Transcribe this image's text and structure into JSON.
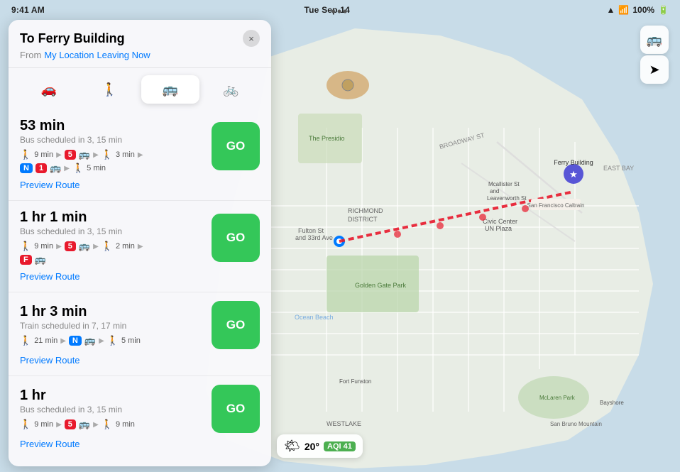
{
  "status_bar": {
    "time": "9:41 AM",
    "date": "Tue Sep 14",
    "battery": "100%",
    "signal_icon": "▲",
    "wifi_icon": "wifi"
  },
  "top_dots": "•••",
  "header": {
    "title": "To Ferry Building",
    "from_label": "From",
    "my_location": "My Location",
    "leaving_now": "Leaving Now",
    "close_icon": "×"
  },
  "mode_tabs": [
    {
      "id": "car",
      "icon": "🚗",
      "label": "Car",
      "active": false
    },
    {
      "id": "walk",
      "icon": "🚶",
      "label": "Walk",
      "active": false
    },
    {
      "id": "transit",
      "icon": "🚌",
      "label": "Transit",
      "active": true
    },
    {
      "id": "bike",
      "icon": "🚲",
      "label": "Bike",
      "active": false
    }
  ],
  "routes": [
    {
      "time": "53 min",
      "subtitle": "Bus scheduled in 3, 15 min",
      "steps_row1": [
        {
          "type": "walk",
          "text": "9 min"
        },
        {
          "type": "arrow"
        },
        {
          "type": "badge",
          "color": "red",
          "text": "5"
        },
        {
          "type": "bus"
        },
        {
          "type": "arrow"
        },
        {
          "type": "walk",
          "text": "3 min"
        },
        {
          "type": "arrow"
        }
      ],
      "steps_row2": [
        {
          "type": "badge-n",
          "text": "N"
        },
        {
          "type": "badge",
          "color": "red",
          "text": "1"
        },
        {
          "type": "bus"
        },
        {
          "type": "arrow"
        },
        {
          "type": "walk",
          "text": "5 min"
        }
      ],
      "go_label": "GO",
      "preview_label": "Preview Route"
    },
    {
      "time": "1 hr 1 min",
      "subtitle": "Bus scheduled in 3, 15 min",
      "steps_row1": [
        {
          "type": "walk",
          "text": "9 min"
        },
        {
          "type": "arrow"
        },
        {
          "type": "badge",
          "color": "red",
          "text": "5"
        },
        {
          "type": "bus"
        },
        {
          "type": "arrow"
        },
        {
          "type": "walk",
          "text": "2 min"
        },
        {
          "type": "arrow"
        }
      ],
      "steps_row2": [
        {
          "type": "badge-f",
          "text": "F"
        },
        {
          "type": "bus"
        }
      ],
      "go_label": "GO",
      "preview_label": "Preview Route"
    },
    {
      "time": "1 hr 3 min",
      "subtitle": "Train scheduled in 7, 17 min",
      "steps_row1": [
        {
          "type": "walk",
          "text": "21 min"
        },
        {
          "type": "arrow"
        },
        {
          "type": "badge-n",
          "text": "N"
        },
        {
          "type": "bus"
        },
        {
          "type": "arrow"
        },
        {
          "type": "walk",
          "text": "5 min"
        }
      ],
      "steps_row2": [],
      "go_label": "GO",
      "preview_label": "Preview Route"
    },
    {
      "time": "1 hr",
      "subtitle": "Bus scheduled in 3, 15 min",
      "steps_row1": [
        {
          "type": "walk",
          "text": "9 min"
        },
        {
          "type": "arrow"
        },
        {
          "type": "badge",
          "color": "red",
          "text": "5"
        },
        {
          "type": "bus"
        },
        {
          "type": "arrow"
        },
        {
          "type": "walk",
          "text": "9 min"
        }
      ],
      "steps_row2": [],
      "go_label": "GO",
      "preview_label": "Preview Route"
    }
  ],
  "map_controls": [
    {
      "id": "transit-view",
      "icon": "🚌"
    },
    {
      "id": "location",
      "icon": "➤"
    }
  ],
  "weather": {
    "icon": "🌤",
    "temp": "20°",
    "aqi_label": "AQI 41"
  },
  "colors": {
    "go_green": "#34C759",
    "blue_link": "#007AFF",
    "red_badge": "#e8192c"
  }
}
